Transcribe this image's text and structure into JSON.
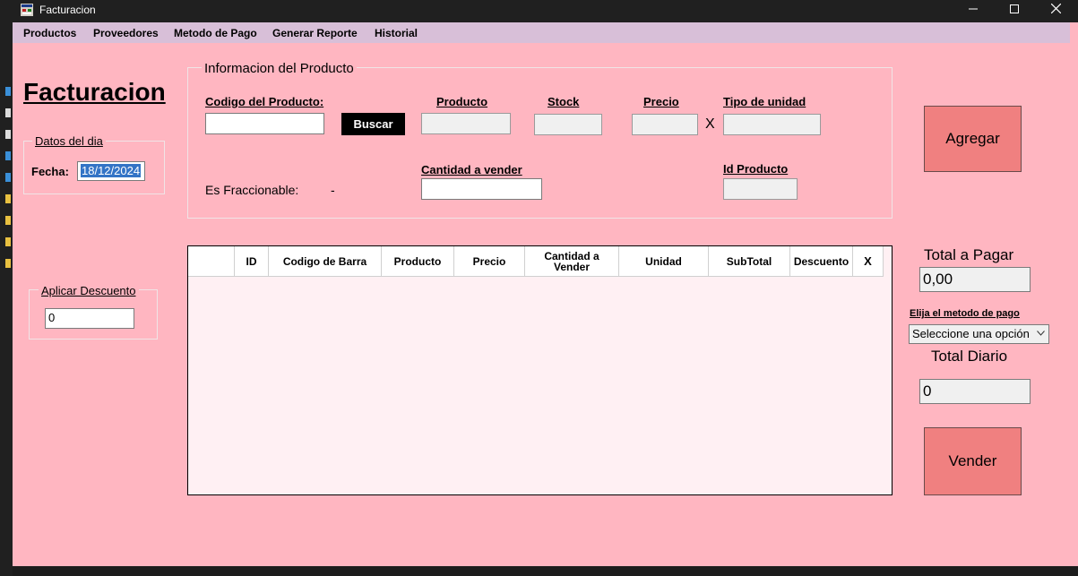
{
  "window": {
    "title": "Facturacion"
  },
  "menu": [
    "Productos",
    "Proveedores",
    "Metodo de Pago",
    "Generar Reporte",
    "Historial"
  ],
  "page_title": "Facturacion",
  "datos_dia": {
    "legend": "Datos del dia",
    "fecha_label": "Fecha:",
    "fecha_value": "18/12/2024"
  },
  "descuento": {
    "legend": "Aplicar Descuento",
    "value": "0"
  },
  "info_producto": {
    "legend": "Informacion del Producto",
    "codigo_label": "Codigo del Producto:",
    "buscar_label": "Buscar",
    "producto_label": "Producto",
    "stock_label": "Stock",
    "precio_label": "Precio",
    "multiply_sign": "X",
    "tipo_unidad_label": "Tipo de unidad",
    "fraccionable_label": "Es Fraccionable:",
    "fraccionable_value": "-",
    "cantidad_label": "Cantidad  a vender",
    "id_producto_label": "Id Producto"
  },
  "grid": {
    "columns": [
      "",
      "ID",
      "Codigo de Barra",
      "Producto",
      "Precio",
      "Cantidad a Vender",
      "Unidad",
      "SubTotal",
      "Descuento",
      "X"
    ]
  },
  "actions": {
    "agregar_label": "Agregar",
    "vender_label": "Vender"
  },
  "totals": {
    "total_pagar_label": "Total a Pagar",
    "total_pagar_value": "0,00",
    "metodo_pago_label": "Elija el metodo de pago",
    "metodo_pago_selected": "Seleccione una opción",
    "total_diario_label": "Total Diario",
    "total_diario_value": "0"
  },
  "colors": {
    "form_bg": "#ffb6c1",
    "menu_bg": "#d8bfd8",
    "button_bg": "#f08080",
    "grid_bg": "#fff0f3"
  }
}
